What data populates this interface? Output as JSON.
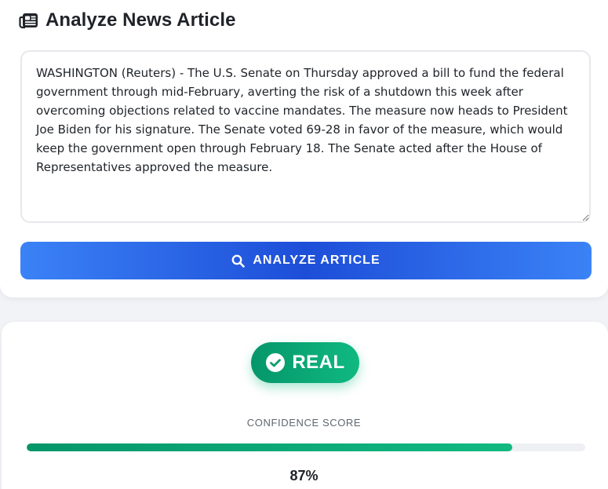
{
  "analyze_section": {
    "title": "Analyze News Article",
    "title_icon": "newspaper-icon",
    "article_text": "WASHINGTON (Reuters) - The U.S. Senate on Thursday approved a bill to fund the federal government through mid-February, averting the risk of a shutdown this week after overcoming objections related to vaccine mandates. The measure now heads to President Joe Biden for his signature. The Senate voted 69-28 in favor of the measure, which would keep the government open through February 18. The Senate acted after the House of Representatives approved the measure.",
    "analyze_button": {
      "label": "ANALYZE ARTICLE",
      "icon": "search-icon"
    }
  },
  "result_section": {
    "verdict": {
      "label": "REAL",
      "icon": "check-circle-icon",
      "color": "#10b981"
    },
    "confidence_label": "CONFIDENCE SCORE",
    "confidence_percent": 87,
    "confidence_text": "87%"
  },
  "colors": {
    "accent_blue": "#3b82f6",
    "accent_blue_dark": "#1d4ed8",
    "success_green": "#059669"
  }
}
